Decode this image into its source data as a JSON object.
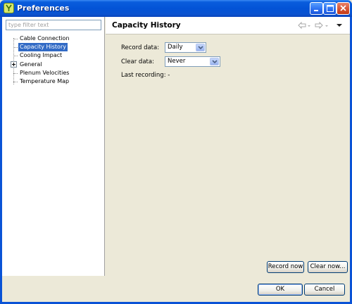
{
  "window": {
    "title": "Preferences",
    "icons": [
      "app-icon",
      "minimize-icon",
      "maximize-icon",
      "close-icon"
    ]
  },
  "sidebar": {
    "filter_placeholder": "type filter text",
    "items": [
      {
        "label": "Cable Connection",
        "selected": false,
        "expandable": false
      },
      {
        "label": "Capacity History",
        "selected": true,
        "expandable": false
      },
      {
        "label": "Cooling Impact",
        "selected": false,
        "expandable": false
      },
      {
        "label": "General",
        "selected": false,
        "expandable": true
      },
      {
        "label": "Plenum Velocities",
        "selected": false,
        "expandable": false
      },
      {
        "label": "Temperature Map",
        "selected": false,
        "expandable": false
      }
    ]
  },
  "page": {
    "title": "Capacity History",
    "nav_icons": [
      "back-arrow-icon",
      "forward-arrow-icon",
      "view-menu-icon"
    ],
    "fields": [
      {
        "label": "Record data:",
        "value": "Daily"
      },
      {
        "label": "Clear data:",
        "value": "Never"
      }
    ],
    "last_recording": "Last recording:  -",
    "record_now": "Record now",
    "clear_now": "Clear now..."
  },
  "footer": {
    "ok": "OK",
    "cancel": "Cancel"
  },
  "colors": {
    "title_bar": "#0a53d6",
    "selection": "#316ac5",
    "dialog_bg": "#ece9d8"
  }
}
